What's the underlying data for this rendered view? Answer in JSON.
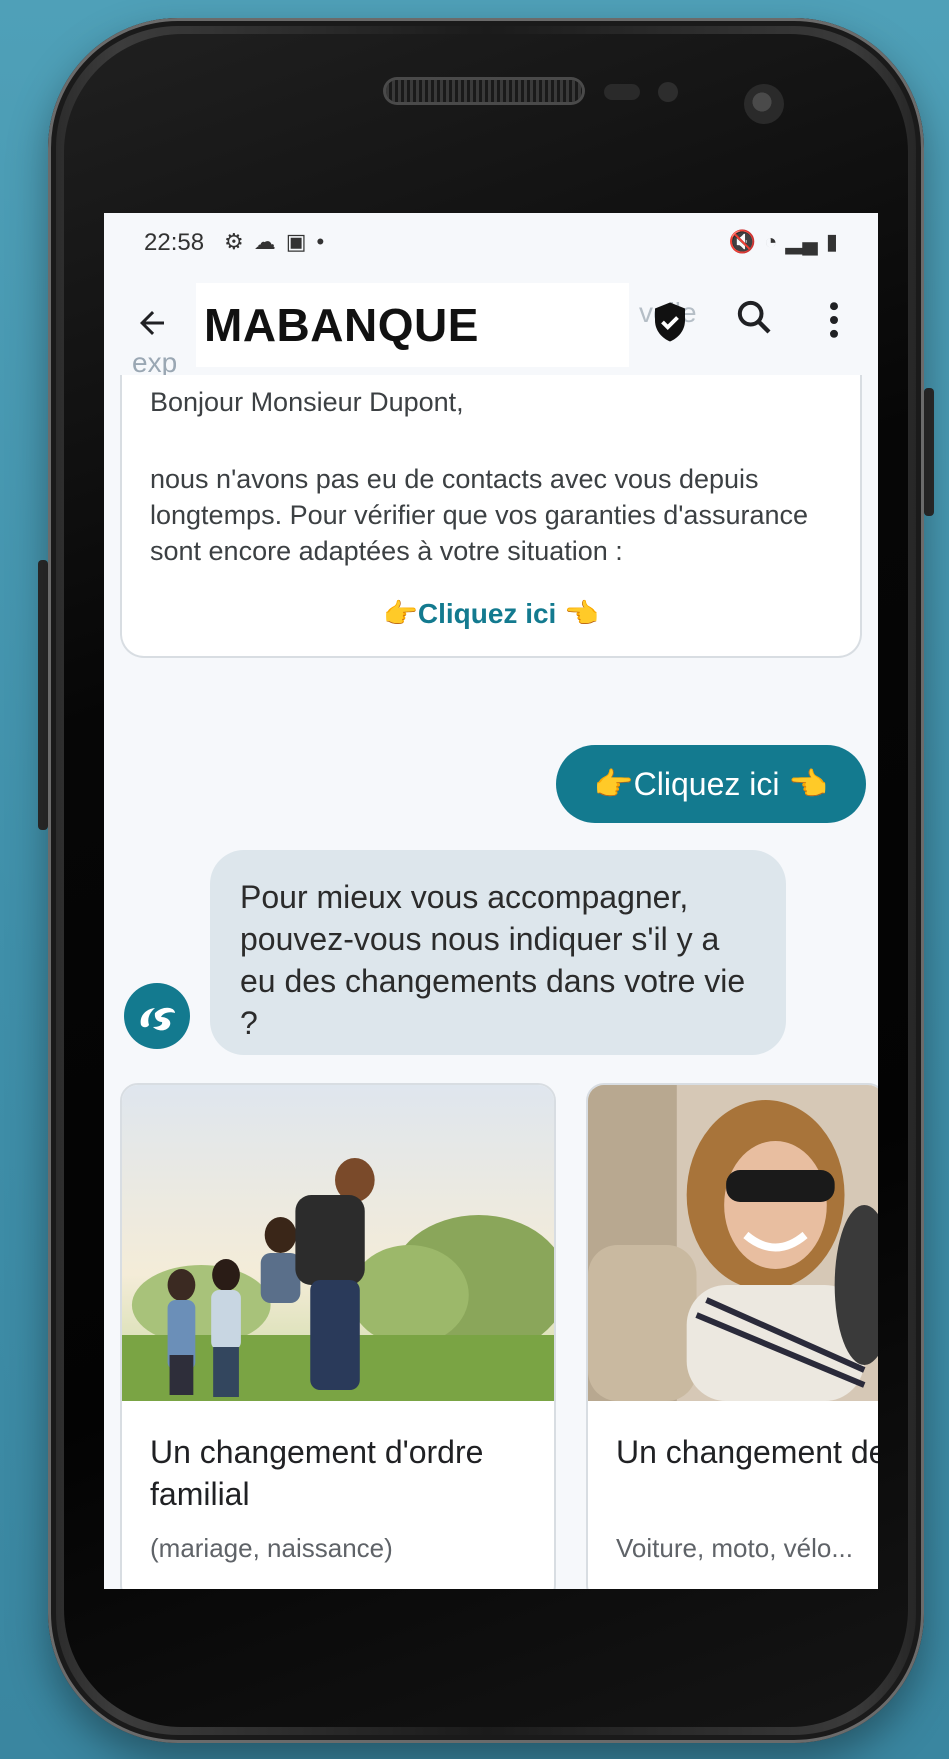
{
  "status_bar": {
    "time": "22:58",
    "left_icons": [
      "gear-icon",
      "cloud-icon",
      "image-icon",
      "dot-icon"
    ],
    "right_icons": [
      "mute-icon",
      "wifi-icon",
      "signal-icon",
      "battery-icon"
    ]
  },
  "app_bar": {
    "title": "MABANQUE",
    "ghost_title": "MA",
    "ghost_right": "velle",
    "ghost_sub": "exp"
  },
  "message": {
    "greeting": "Bonjour Monsieur Dupont,",
    "body": "nous n'avons pas eu de contacts avec vous depuis longtemps. Pour vérifier que vos garanties d'assurance sont encore adaptées à votre situation :",
    "link": "👉Cliquez ici 👈"
  },
  "reply_chip": {
    "label": "👉Cliquez ici 👈"
  },
  "bot_message": {
    "text": "Pour mieux vous accompagner, pouvez-vous nous indiquer s'il y a eu des changements dans votre vie ?"
  },
  "cards": [
    {
      "title": "Un changement d'ordre familial",
      "subtitle": "(mariage, naissance)"
    },
    {
      "title": "Un changement de mobilité",
      "subtitle": "Voiture, moto, vélo..."
    }
  ],
  "colors": {
    "accent": "#137a8f",
    "bubble": "#dde6ec",
    "background": "#4a9bb4"
  }
}
